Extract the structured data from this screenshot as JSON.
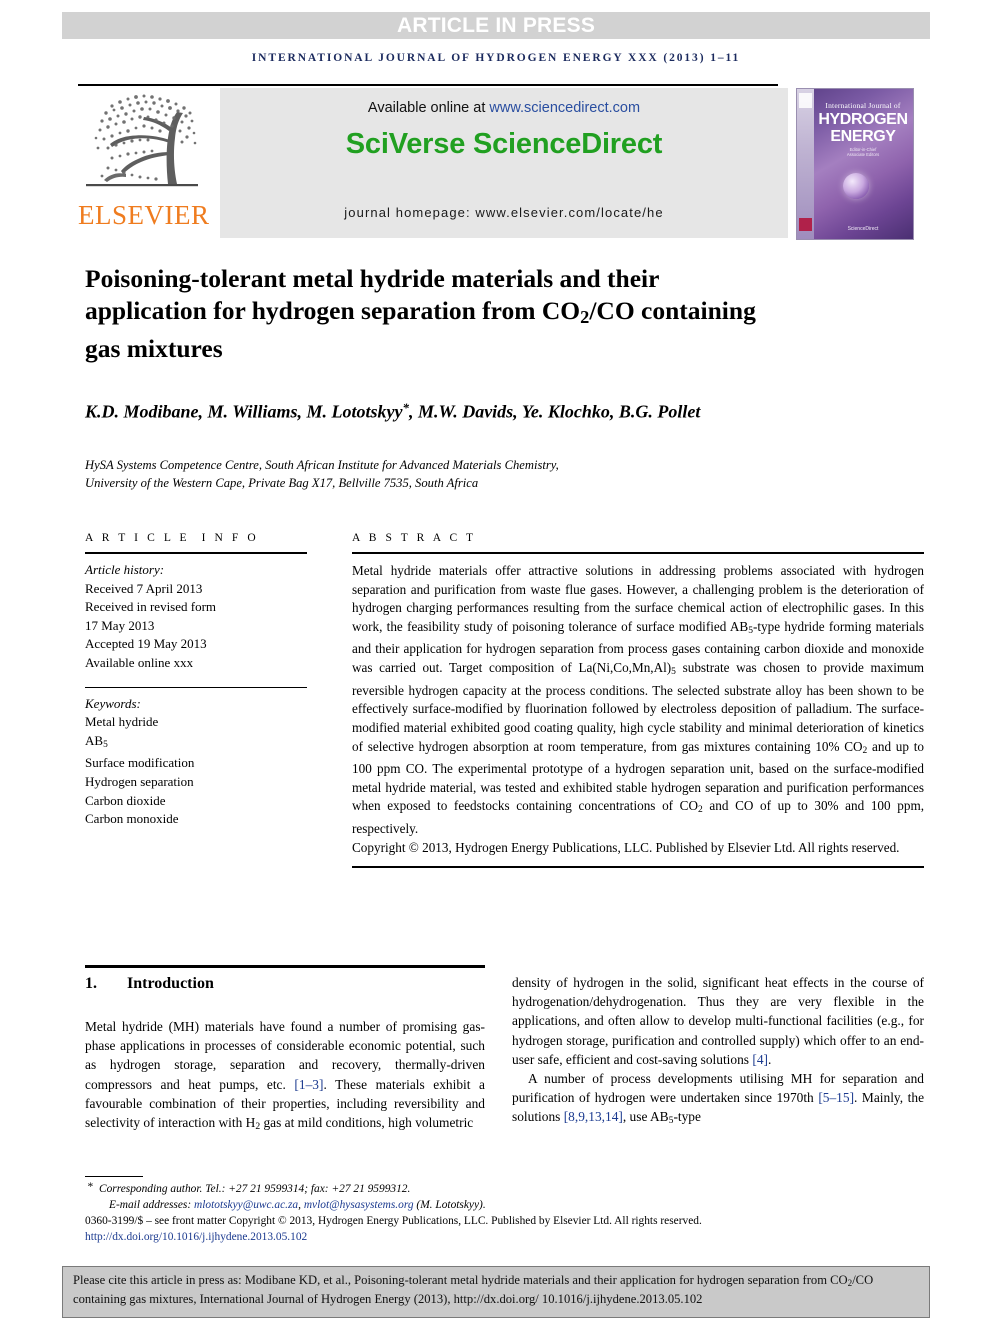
{
  "banner": {
    "label": "ARTICLE IN PRESS"
  },
  "running_head": "INTERNATIONAL JOURNAL OF HYDROGEN ENERGY XXX (2013) 1–11",
  "masthead": {
    "publisher_name": "ELSEVIER",
    "available_prefix": "Available online at ",
    "available_link": "www.sciencedirect.com",
    "brand": "SciVerse ScienceDirect",
    "homepage": "journal homepage: www.elsevier.com/locate/he",
    "cover": {
      "line_small": "International Journal of",
      "line_hydrogen": "HYDROGEN",
      "line_energy": "ENERGY",
      "editors": "Editor-in-Chief: T. Nejat Veziroglu\nAssociate Editors: S. Kartha, B.C. Pandey, A. A. Lemes, A.L. Mendes, J.W. Sheffield, L.v. Trust and D.A. Sveinsdy",
      "sciencedirect": "Available online at\nScienceDirect"
    }
  },
  "article": {
    "title": "Poisoning-tolerant metal hydride materials and their application for hydrogen separation from CO₂/CO containing gas mixtures",
    "title_lines": [
      "Poisoning-tolerant metal hydride materials and",
      "their application for hydrogen separation from",
      "CO2/CO containing gas mixtures"
    ],
    "authors": "K.D. Modibane, M. Williams, M. Lototskyy*, M.W. Davids, Ye. Klochko, B.G. Pollet",
    "affiliation_lines": [
      "HySA Systems Competence Centre, South African Institute for Advanced Materials Chemistry,",
      "University of the Western Cape, Private Bag X17, Bellville 7535, South Africa"
    ]
  },
  "info": {
    "heading": "ARTICLE INFO",
    "history_label": "Article history:",
    "history": [
      "Received 7 April 2013",
      "Received in revised form",
      "17 May 2013",
      "Accepted 19 May 2013",
      "Available online xxx"
    ],
    "keywords_label": "Keywords:",
    "keywords": [
      "Metal hydride",
      "AB5",
      "Surface modification",
      "Hydrogen separation",
      "Carbon dioxide",
      "Carbon monoxide"
    ]
  },
  "abstract": {
    "heading": "ABSTRACT",
    "body": "Metal hydride materials offer attractive solutions in addressing problems associated with hydrogen separation and purification from waste flue gases. However, a challenging problem is the deterioration of hydrogen charging performances resulting from the surface chemical action of electrophilic gases. In this work, the feasibility study of poisoning tolerance of surface modified AB5-type hydride forming materials and their application for hydrogen separation from process gases containing carbon dioxide and monoxide was carried out. Target composition of La(Ni,Co,Mn,Al)5 substrate was chosen to provide maximum reversible hydrogen capacity at the process conditions. The selected substrate alloy has been shown to be effectively surface-modified by fluorination followed by electroless deposition of palladium. The surface-modified material exhibited good coating quality, high cycle stability and minimal deterioration of kinetics of selective hydrogen absorption at room temperature, from gas mixtures containing 10% CO2 and up to 100 ppm CO. The experimental prototype of a hydrogen separation unit, based on the surface-modified metal hydride material, was tested and exhibited stable hydrogen separation and purification performances when exposed to feedstocks containing concentrations of CO2 and CO of up to 30% and 100 ppm, respectively.",
    "copyright": "Copyright © 2013, Hydrogen Energy Publications, LLC. Published by Elsevier Ltd. All rights reserved."
  },
  "introduction": {
    "number": "1.",
    "heading": "Introduction",
    "paragraph1": "Metal hydride (MH) materials have found a number of promising gas-phase applications in processes of considerable economic potential, such as hydrogen storage, separation and recovery, thermally-driven compressors and heat pumps, etc. [1–3]. These materials exhibit a favourable combination of their properties, including reversibility and selectivity of interaction with H2 gas at mild conditions, high volumetric density of hydrogen in the solid, significant heat effects in the course of hydrogenation/dehydrogenation. Thus they are very flexible in the applications, and often allow to develop multi-functional facilities (e.g., for hydrogen storage, purification and controlled supply) which offer to an end-user safe, efficient and cost-saving solutions [4].",
    "paragraph2": "A number of process developments utilising MH for separation and purification of hydrogen were undertaken since 1970th [5–15]. Mainly, the solutions [8,9,13,14], use AB5-type"
  },
  "footnotes": {
    "corresponding": "Corresponding author. Tel.: +27 21 9599314; fax: +27 21 9599312.",
    "email_label": "E-mail addresses: ",
    "email1": "mlototskyy@uwc.ac.za",
    "email_sep": ", ",
    "email2": "mvlot@hysasystems.org",
    "email_suffix": " (M. Lototskyy).",
    "issn_line": "0360-3199/$ – see front matter Copyright © 2013, Hydrogen Energy Publications, LLC. Published by Elsevier Ltd. All rights reserved.",
    "doi": "http://dx.doi.org/10.1016/j.ijhydene.2013.05.102"
  },
  "cite_box": {
    "text": "Please cite this article in press as: Modibane KD, et al., Poisoning-tolerant metal hydride materials and their application for hydrogen separation from CO2/CO containing gas mixtures, International Journal of Hydrogen Energy (2013), http://dx.doi.org/10.1016/j.ijhydene.2013.05.102"
  },
  "colors": {
    "banner_bg": "#d2d2d2",
    "running_head": "#1b2a5e",
    "elsevier_orange": "#ef7c1f",
    "sciencedirect_green": "#21a021",
    "link_blue": "#2a4ea0",
    "reference_blue": "#1b3a8f",
    "cite_box_bg": "#c9c9c9",
    "sd_box_bg": "#e6e6e6"
  }
}
